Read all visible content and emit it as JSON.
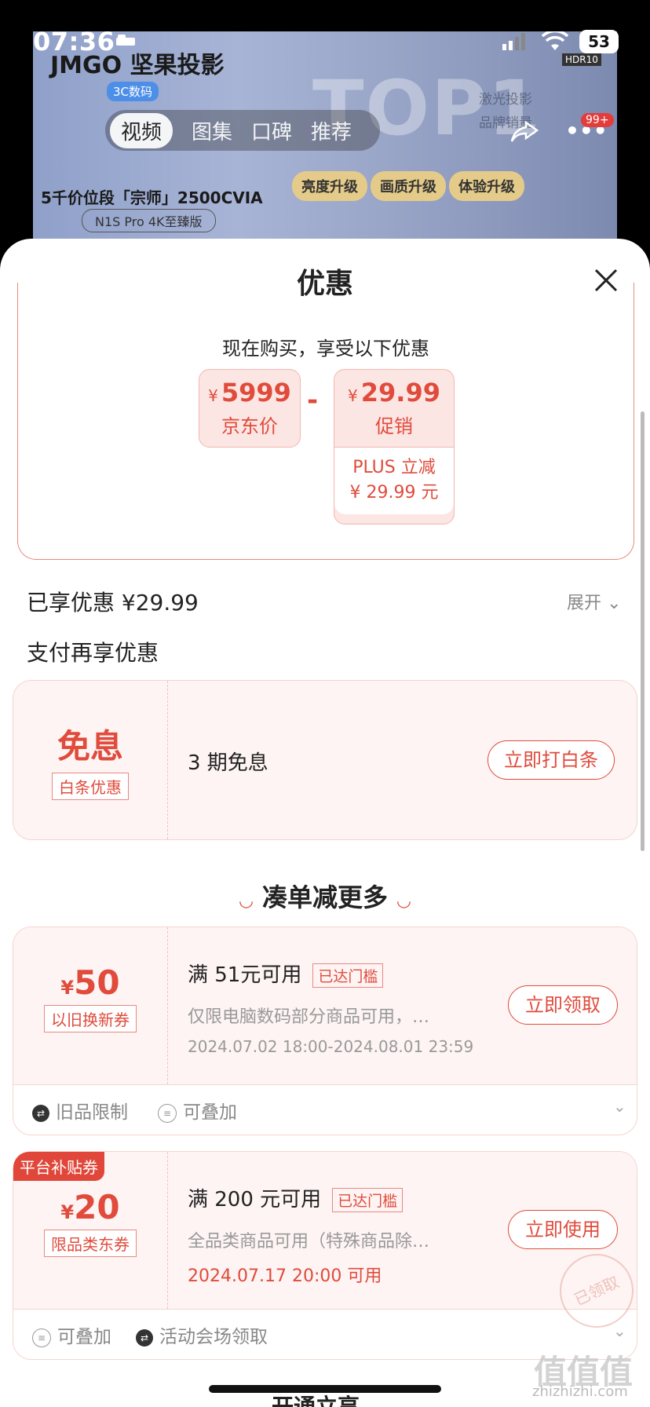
{
  "status": {
    "time": "07:36",
    "battery": "53"
  },
  "hero": {
    "brand": "JMGO 坚果投影",
    "badge": "3C数码",
    "top1": "TOP1",
    "laser_line1": "激光投影",
    "laser_line2": "品牌销量",
    "upgrades": [
      "亮度升级",
      "画质升级",
      "体验升级"
    ],
    "ribbon": "5千价位段「宗师」2500CVIA",
    "subtag": "N1S Pro 4K至臻版",
    "hdr": "HDR10",
    "tabs": [
      "视频",
      "图集",
      "口碑",
      "推荐"
    ],
    "msg_badge": "99+"
  },
  "sheet": {
    "title": "优惠",
    "promo_head": "现在购买，享受以下优惠",
    "price_card": {
      "symbol": "¥",
      "amount": "5999",
      "label": "京东价"
    },
    "minus": "-",
    "promo_card": {
      "symbol": "¥",
      "amount": "29.99",
      "label": "促销",
      "plus_line1": "PLUS 立减",
      "plus_line2": "¥ 29.99 元"
    },
    "enjoyed": "已享优惠 ¥29.99",
    "expand": "展开",
    "pay_more": "支付再享优惠",
    "baitiao": {
      "big": "免息",
      "tag": "白条优惠",
      "desc": "3 期免息",
      "btn": "立即打白条"
    },
    "section": "凑单减更多",
    "coupon1": {
      "symbol": "¥",
      "amount": "50",
      "tag": "以旧换新券",
      "title": "满 51元可用",
      "met": "已达门槛",
      "desc": "仅限电脑数码部分商品可用，…",
      "time": "2024.07.02 18:00-2024.08.01 23:59",
      "btn": "立即领取",
      "features": [
        "旧品限制",
        "可叠加"
      ]
    },
    "coupon2": {
      "corner": "平台补贴券",
      "symbol": "¥",
      "amount": "20",
      "tag": "限品类东券",
      "title": "满 200 元可用",
      "met": "已达门槛",
      "desc": "全品类商品可用（特殊商品除…",
      "time": "2024.07.17 20:00 可用",
      "btn": "立即使用",
      "stamp": "已领取",
      "features": [
        "可叠加",
        "活动会场领取"
      ]
    },
    "bottom_text": "开通立享"
  },
  "watermark": {
    "main": "值值值",
    "sub": "zhizhizhi.com"
  }
}
